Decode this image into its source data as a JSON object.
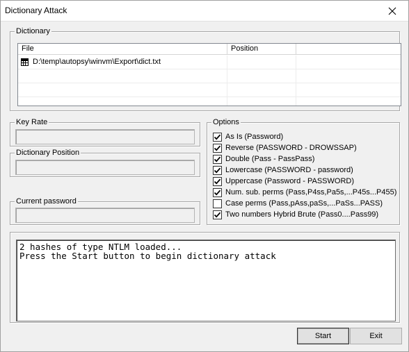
{
  "window": {
    "title": "Dictionary Attack"
  },
  "dictionary": {
    "group_label": "Dictionary",
    "columns": [
      "File",
      "Position"
    ],
    "rows": [
      {
        "file": "D:\\temp\\autopsy\\winvm\\Export\\dict.txt",
        "position": ""
      }
    ]
  },
  "key_rate": {
    "label": "Key Rate",
    "value": ""
  },
  "dictionary_position": {
    "label": "Dictionary Position",
    "value": ""
  },
  "current_password": {
    "label": "Current password",
    "value": ""
  },
  "options": {
    "group_label": "Options",
    "items": [
      {
        "label": "As Is (Password)",
        "checked": true
      },
      {
        "label": "Reverse (PASSWORD - DROWSSAP)",
        "checked": true
      },
      {
        "label": "Double (Pass - PassPass)",
        "checked": true
      },
      {
        "label": "Lowercase (PASSWORD - password)",
        "checked": true
      },
      {
        "label": "Uppercase (Password - PASSWORD)",
        "checked": true
      },
      {
        "label": "Num. sub. perms (Pass,P4ss,Pa5s,...P45s...P455)",
        "checked": true
      },
      {
        "label": "Case perms (Pass,pAss,paSs,...PaSs...PASS)",
        "checked": false
      },
      {
        "label": "Two numbers Hybrid Brute (Pass0....Pass99)",
        "checked": true
      }
    ]
  },
  "output": {
    "lines": [
      "2 hashes of type NTLM loaded...",
      "Press the Start button to begin dictionary attack"
    ]
  },
  "buttons": {
    "start": "Start",
    "exit": "Exit"
  }
}
